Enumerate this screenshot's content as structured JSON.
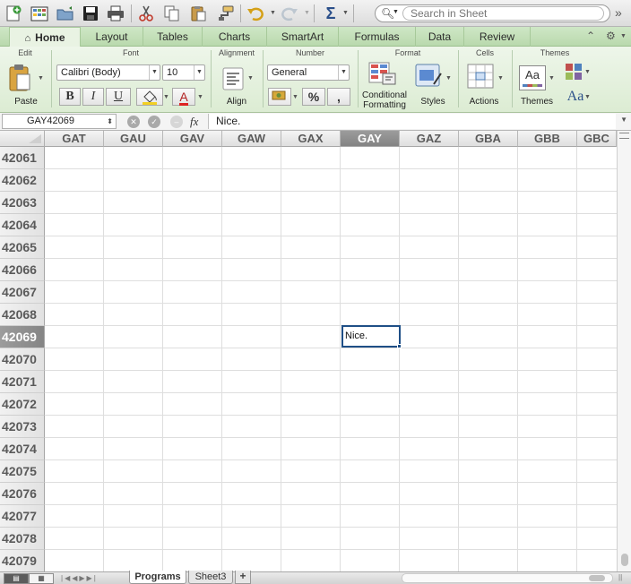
{
  "toolbar": {
    "icons": [
      "new-workbook-icon",
      "templates-icon",
      "open-icon",
      "save-icon",
      "print-icon",
      "cut-icon",
      "copy-icon",
      "paste-icon",
      "format-painter-icon",
      "undo-icon",
      "redo-icon",
      "autosum-icon"
    ],
    "search_placeholder": "Search in Sheet"
  },
  "ribbon_tabs": [
    "Home",
    "Layout",
    "Tables",
    "Charts",
    "SmartArt",
    "Formulas",
    "Data",
    "Review"
  ],
  "ribbon": {
    "groups": {
      "edit": "Edit",
      "font": "Font",
      "alignment": "Alignment",
      "number": "Number",
      "format": "Format",
      "cells": "Cells",
      "themes": "Themes"
    },
    "paste_label": "Paste",
    "font_name": "Calibri (Body)",
    "font_size": "10",
    "bold": "B",
    "italic": "I",
    "underline": "U",
    "align_label": "Align",
    "number_format": "General",
    "percent": "%",
    "comma": ",",
    "conditional_formatting_label_1": "Conditional",
    "conditional_formatting_label_2": "Formatting",
    "styles_label": "Styles",
    "actions_label": "Actions",
    "themes_label": "Themes",
    "themes_font_glyph": "Aa",
    "theme_preview_text": "Aa"
  },
  "formula_bar": {
    "name_box": "GAY42069",
    "fx": "fx",
    "content": "Nice."
  },
  "grid": {
    "columns": [
      "GAT",
      "GAU",
      "GAV",
      "GAW",
      "GAX",
      "GAY",
      "GAZ",
      "GBA",
      "GBB",
      "GBC"
    ],
    "selected_column": "GAY",
    "rows": [
      "42061",
      "42062",
      "42063",
      "42064",
      "42065",
      "42066",
      "42067",
      "42068",
      "42069",
      "42070",
      "42071",
      "42072",
      "42073",
      "42074",
      "42075",
      "42076",
      "42077",
      "42078",
      "42079"
    ],
    "selected_row": "42069",
    "active_cell_value": "Nice."
  },
  "sheets": {
    "tabs": [
      "Programs",
      "Sheet3"
    ],
    "active": "Programs",
    "add_label": "+"
  },
  "colors": {
    "ribbon_green": "#cfe7c6",
    "selection_border": "#1f4f86",
    "header_selected": "#8c8c8c"
  }
}
